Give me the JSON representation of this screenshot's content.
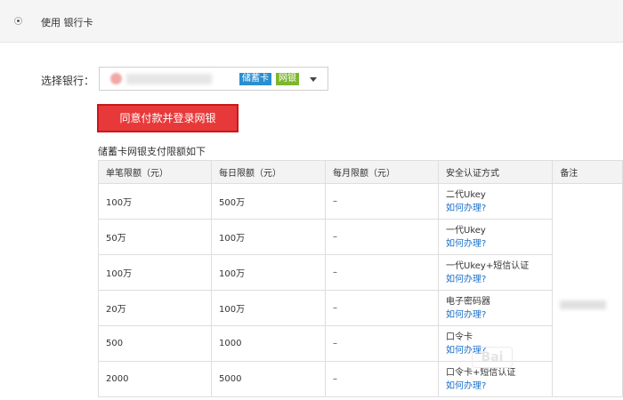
{
  "payment_method": {
    "label": "使用 银行卡",
    "selected": true
  },
  "bank_select": {
    "label": "选择银行：",
    "card_tag": "储蓄卡",
    "net_tag": "网银",
    "tag_colors": {
      "card": "#2a8fd0",
      "net": "#7cb72d"
    }
  },
  "agree_button": {
    "label": "同意付款并登录网银",
    "color": "#e8393a"
  },
  "limits": {
    "caption": "储蓄卡网银支付限额如下",
    "headers": [
      "单笔限额（元）",
      "每日限额（元）",
      "每月限额（元）",
      "安全认证方式",
      "备注"
    ],
    "rows": [
      {
        "single": "100万",
        "daily": "500万",
        "monthly": "–",
        "auth": "二代Ukey",
        "link": "如何办理?"
      },
      {
        "single": "50万",
        "daily": "100万",
        "monthly": "–",
        "auth": "一代Ukey",
        "link": "如何办理?"
      },
      {
        "single": "100万",
        "daily": "100万",
        "monthly": "–",
        "auth": "一代Ukey+短信认证",
        "link": "如何办理?"
      },
      {
        "single": "20万",
        "daily": "100万",
        "monthly": "–",
        "auth": "电子密码器",
        "link": "如何办理?"
      },
      {
        "single": "500",
        "daily": "1000",
        "monthly": "–",
        "auth": "口令卡",
        "link": "如何办理?"
      },
      {
        "single": "2000",
        "daily": "5000",
        "monthly": "–",
        "auth": "口令卡+短信认证",
        "link": "如何办理?"
      }
    ],
    "link_color": "#1a6fc9"
  },
  "icons": {
    "radio": "radio-selected-icon",
    "caret": "chevron-down-icon"
  }
}
